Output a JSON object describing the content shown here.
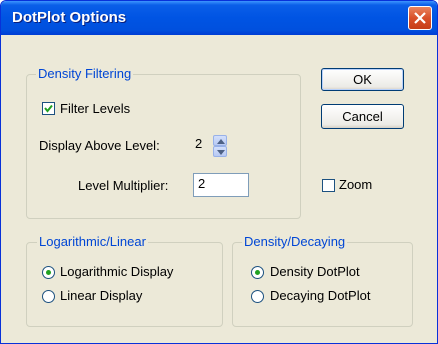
{
  "window": {
    "title": "DotPlot Options"
  },
  "density_filtering": {
    "legend": "Density Filtering",
    "filter_levels": {
      "label": "Filter Levels",
      "checked": true
    },
    "display_above_level": {
      "label": "Display Above Level:",
      "value": "2"
    },
    "level_multiplier": {
      "label": "Level Multiplier:",
      "value": "2"
    }
  },
  "buttons": {
    "ok": "OK",
    "cancel": "Cancel"
  },
  "zoom": {
    "label": "Zoom",
    "checked": false
  },
  "log_linear": {
    "legend": "Logarithmic/Linear",
    "options": [
      "Logarithmic Display",
      "Linear Display"
    ],
    "selected": "Logarithmic Display"
  },
  "density_decaying": {
    "legend": "Density/Decaying",
    "options": [
      "Density DotPlot",
      "Decaying DotPlot"
    ],
    "selected": "Density DotPlot"
  },
  "colors": {
    "title_bar": "#0054e3",
    "dialog_bg": "#ece9d8",
    "group_label": "#0046d5",
    "close_button": "#d9502a"
  }
}
